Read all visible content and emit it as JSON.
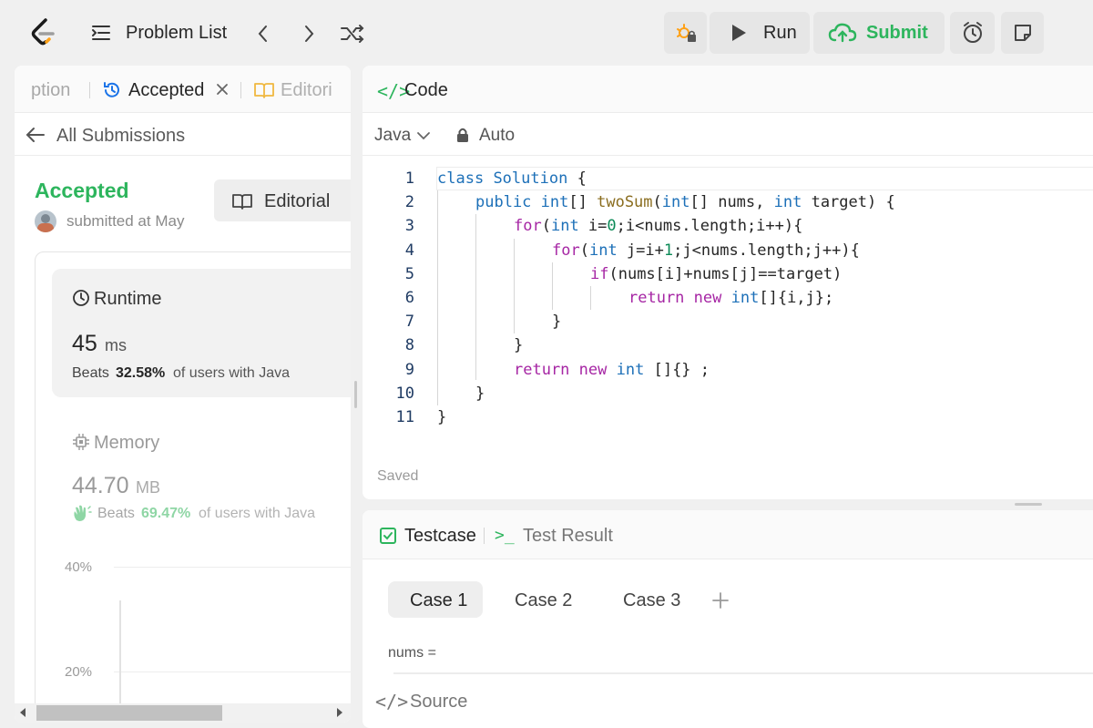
{
  "topbar": {
    "problem_list": "Problem List",
    "run": "Run",
    "submit": "Submit"
  },
  "left": {
    "tabs": [
      "ption",
      "Accepted",
      "Editori"
    ],
    "all_submissions": "All Submissions",
    "status": "Accepted",
    "submitted_at": "submitted at May",
    "editorial": "Editorial",
    "runtime": {
      "label": "Runtime",
      "value": "45",
      "unit": "ms",
      "beats_prefix": "Beats",
      "beats_value": "32.58%",
      "beats_suffix": "of users with Java"
    },
    "memory": {
      "label": "Memory",
      "value": "44.70",
      "unit": "MB",
      "beats_prefix": "Beats",
      "beats_value": "69.47%",
      "beats_suffix": "of users with Java"
    },
    "chart_ticks": [
      "40%",
      "20%"
    ]
  },
  "code": {
    "title": "Code",
    "language": "Java",
    "mode": "Auto",
    "saved": "Saved",
    "line_numbers": [
      "1",
      "2",
      "3",
      "4",
      "5",
      "6",
      "7",
      "8",
      "9",
      "10",
      "11"
    ]
  },
  "testcase": {
    "tab_testcase": "Testcase",
    "tab_result": "Test Result",
    "cases": [
      "Case 1",
      "Case 2",
      "Case 3"
    ],
    "field_label": "nums =",
    "source": "Source"
  },
  "colors": {
    "accent_green": "#2db55d",
    "accent_orange": "#ffa116",
    "link_blue": "#1a73e8"
  }
}
